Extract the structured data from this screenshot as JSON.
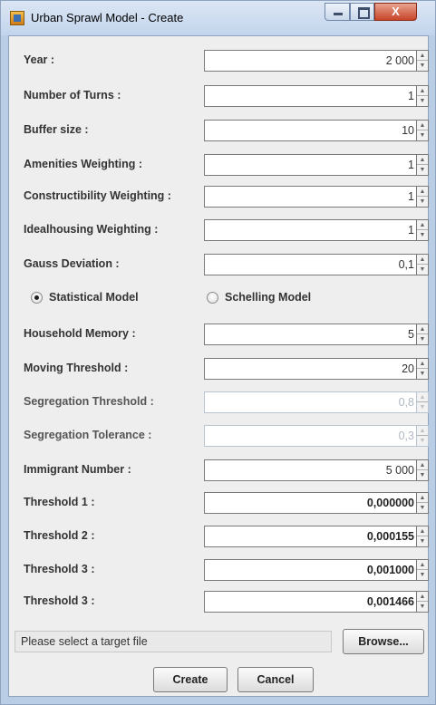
{
  "window": {
    "title": "Urban Sprawl Model - Create",
    "close_glyph": "X"
  },
  "params": [
    {
      "label": "Year :",
      "value": "2 000",
      "enabled": true
    },
    {
      "label": "Number of Turns :",
      "value": "1",
      "enabled": true
    },
    {
      "label": "Buffer size :",
      "value": "10",
      "enabled": true
    },
    {
      "label": "Amenities Weighting :",
      "value": "1",
      "enabled": true
    },
    {
      "label": "Constructibility Weighting :",
      "value": "1",
      "enabled": true
    },
    {
      "label": "Idealhousing Weighting :",
      "value": "1",
      "enabled": true
    },
    {
      "label": "Gauss Deviation :",
      "value": "0,1",
      "enabled": true
    }
  ],
  "model": {
    "statistical_label": "Statistical Model",
    "schelling_label": "Schelling Model",
    "selected": "statistical"
  },
  "params2": [
    {
      "label": "Household Memory :",
      "value": "5",
      "enabled": true
    },
    {
      "label": "Moving Threshold :",
      "value": "20",
      "enabled": true
    },
    {
      "label": "Segregation Threshold :",
      "value": "0,8",
      "enabled": false
    },
    {
      "label": "Segregation Tolerance :",
      "value": "0,3",
      "enabled": false
    },
    {
      "label": "Immigrant Number :",
      "value": "5 000",
      "enabled": true
    },
    {
      "label": "Threshold 1 :",
      "value": "0,000000",
      "enabled": true
    },
    {
      "label": "Threshold 2 :",
      "value": "0,000155",
      "enabled": true
    },
    {
      "label": "Threshold 3 :",
      "value": "0,001000",
      "enabled": true
    },
    {
      "label": "Threshold 3 :",
      "value": "0,001466",
      "enabled": true
    }
  ],
  "file": {
    "status_text": "Please select a target file",
    "browse_label": "Browse..."
  },
  "actions": {
    "create_label": "Create",
    "cancel_label": "Cancel"
  },
  "icons": {
    "app": "java-app-icon",
    "spinner_up": "arrow-up-icon",
    "spinner_down": "arrow-down-icon"
  }
}
